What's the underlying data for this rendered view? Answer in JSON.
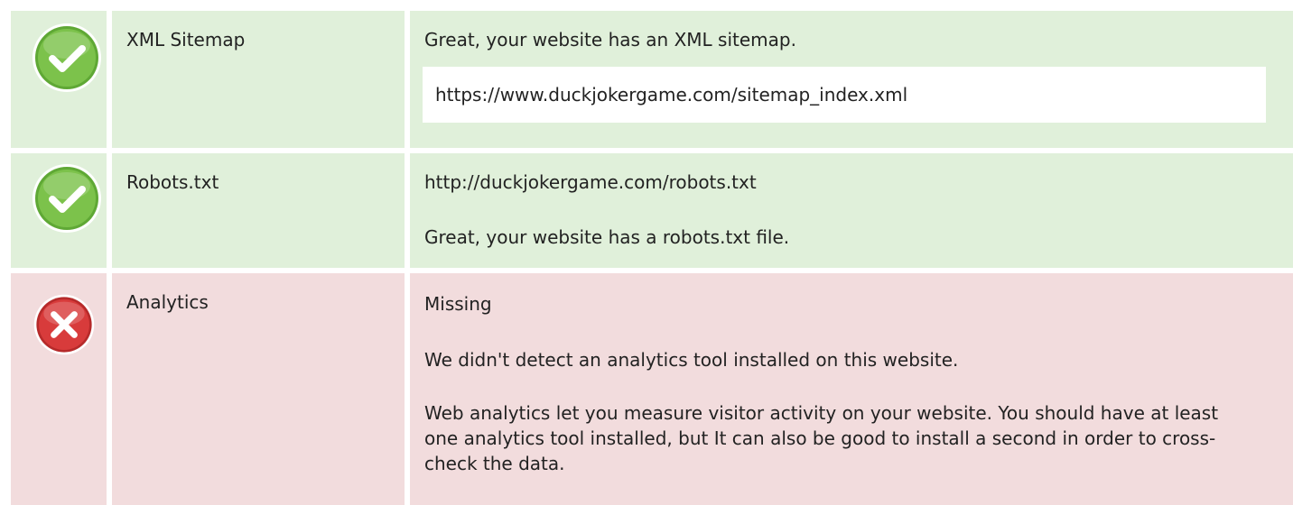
{
  "colors": {
    "pass_background": "#e0f0da",
    "fail_background": "#f2dcdd",
    "pass_icon": "#7cc24b",
    "fail_icon": "#d83b3b"
  },
  "checks": {
    "sitemap": {
      "status": "pass",
      "icon": "check-circle-icon",
      "label": "XML Sitemap",
      "message": "Great, your website has an XML sitemap.",
      "url": "https://www.duckjokergame.com/sitemap_index.xml"
    },
    "robots": {
      "status": "pass",
      "icon": "check-circle-icon",
      "label": "Robots.txt",
      "url": "http://duckjokergame.com/robots.txt",
      "message": "Great, your website has a robots.txt file."
    },
    "analytics": {
      "status": "fail",
      "icon": "error-circle-icon",
      "label": "Analytics",
      "result": "Missing",
      "message": "We didn't detect an analytics tool installed on this website.",
      "advice": "Web analytics let you measure visitor activity on your website. You should have at least one analytics tool installed, but It can also be good to install a second in order to cross-check the data."
    }
  }
}
